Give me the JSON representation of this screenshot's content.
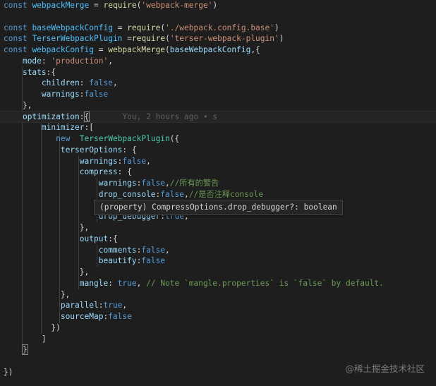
{
  "colors": {
    "background": "#1e1e1e",
    "keyword": "#569cd6",
    "variable": "#4fc1ff",
    "function": "#dcdcaa",
    "string": "#ce9178",
    "property": "#9cdcfe",
    "comment": "#6a9955",
    "class": "#4ec9b0",
    "hover_background": "#252526"
  },
  "lines": [
    [
      [
        "kw",
        "const"
      ],
      [
        "pun",
        " "
      ],
      [
        "var",
        "webpackMerge"
      ],
      [
        "pun",
        " = "
      ],
      [
        "fn",
        "require"
      ],
      [
        "pun",
        "("
      ],
      [
        "str",
        "'webpack-merge'"
      ],
      [
        "pun",
        ")"
      ]
    ],
    [],
    [
      [
        "kw",
        "const"
      ],
      [
        "pun",
        " "
      ],
      [
        "var",
        "baseWebpackConfig"
      ],
      [
        "pun",
        " = "
      ],
      [
        "fn",
        "require"
      ],
      [
        "pun",
        "("
      ],
      [
        "str",
        "'./webpack.config.base'"
      ],
      [
        "pun",
        ")"
      ]
    ],
    [
      [
        "kw",
        "const"
      ],
      [
        "pun",
        " "
      ],
      [
        "var",
        "TerserWebpackPlugin"
      ],
      [
        "pun",
        " ="
      ],
      [
        "fn",
        "require"
      ],
      [
        "pun",
        "("
      ],
      [
        "str",
        "'terser-webpack-plugin'"
      ],
      [
        "pun",
        ")"
      ]
    ],
    [
      [
        "kw",
        "const"
      ],
      [
        "pun",
        " "
      ],
      [
        "var",
        "webpackConfig"
      ],
      [
        "pun",
        " = "
      ],
      [
        "fn",
        "webpackMerge"
      ],
      [
        "pun",
        "("
      ],
      [
        "prop",
        "baseWebpackConfig"
      ],
      [
        "pun",
        ",{"
      ]
    ],
    [
      [
        "pun",
        "    "
      ],
      [
        "prop",
        "mode"
      ],
      [
        "pun",
        ": "
      ],
      [
        "str",
        "'production'"
      ],
      [
        "pun",
        ","
      ]
    ],
    [
      [
        "pun",
        "    "
      ],
      [
        "prop",
        "stats"
      ],
      [
        "pun",
        ":{"
      ]
    ],
    [
      [
        "pun",
        "        "
      ],
      [
        "prop",
        "children"
      ],
      [
        "pun",
        ": "
      ],
      [
        "kw",
        "false"
      ],
      [
        "pun",
        ","
      ]
    ],
    [
      [
        "pun",
        "        "
      ],
      [
        "prop",
        "warnings"
      ],
      [
        "pun",
        ":"
      ],
      [
        "kw",
        "false"
      ]
    ],
    [
      [
        "pun",
        "    },"
      ]
    ],
    [
      [
        "pun",
        "    "
      ],
      [
        "prop",
        "optimization"
      ],
      [
        "pun",
        ":"
      ],
      [
        "bm",
        "{"
      ],
      [
        "pun",
        "       "
      ],
      [
        "ghost",
        "You, 2 hours ago • s"
      ]
    ],
    [
      [
        "pun",
        "        "
      ],
      [
        "prop",
        "minimizer"
      ],
      [
        "pun",
        ":["
      ]
    ],
    [
      [
        "pun",
        "           "
      ],
      [
        "kw",
        "new"
      ],
      [
        "pun",
        "  "
      ],
      [
        "cls",
        "TerserWebpackPlugin"
      ],
      [
        "pun",
        "({"
      ]
    ],
    [
      [
        "pun",
        "            "
      ],
      [
        "prop",
        "terserOptions"
      ],
      [
        "pun",
        ": {"
      ]
    ],
    [
      [
        "pun",
        "                "
      ],
      [
        "prop",
        "warnings"
      ],
      [
        "pun",
        ":"
      ],
      [
        "kw",
        "false"
      ],
      [
        "pun",
        ","
      ]
    ],
    [
      [
        "pun",
        "                "
      ],
      [
        "prop",
        "compress"
      ],
      [
        "pun",
        ": {"
      ]
    ],
    [
      [
        "pun",
        "                    "
      ],
      [
        "prop",
        "warnings"
      ],
      [
        "pun",
        ":"
      ],
      [
        "kw",
        "false"
      ],
      [
        "pun",
        ","
      ],
      [
        "cmt",
        "//所有的警告"
      ]
    ],
    [
      [
        "pun",
        "                    "
      ],
      [
        "prop",
        "drop_console"
      ],
      [
        "pun",
        ":"
      ],
      [
        "kw",
        "false"
      ],
      [
        "pun",
        ","
      ],
      [
        "cmt",
        "//是否注释console"
      ]
    ],
    [],
    [
      [
        "pun",
        "                    "
      ],
      [
        "prop",
        "drop_debugger"
      ],
      [
        "pun",
        ":"
      ],
      [
        "kw",
        "true"
      ],
      [
        "pun",
        ","
      ]
    ],
    [
      [
        "pun",
        "                },"
      ]
    ],
    [
      [
        "pun",
        "                "
      ],
      [
        "prop",
        "output"
      ],
      [
        "pun",
        ":{"
      ]
    ],
    [
      [
        "pun",
        "                    "
      ],
      [
        "prop",
        "comments"
      ],
      [
        "pun",
        ":"
      ],
      [
        "kw",
        "false"
      ],
      [
        "pun",
        ","
      ]
    ],
    [
      [
        "pun",
        "                    "
      ],
      [
        "prop",
        "beautify"
      ],
      [
        "pun",
        ":"
      ],
      [
        "kw",
        "false"
      ]
    ],
    [
      [
        "pun",
        "                },"
      ]
    ],
    [
      [
        "pun",
        "                "
      ],
      [
        "prop",
        "mangle"
      ],
      [
        "pun",
        ": "
      ],
      [
        "kw",
        "true"
      ],
      [
        "pun",
        ", "
      ],
      [
        "cmt",
        "// Note `mangle.properties` is `false` by default."
      ]
    ],
    [
      [
        "pun",
        "            },"
      ]
    ],
    [
      [
        "pun",
        "            "
      ],
      [
        "prop",
        "parallel"
      ],
      [
        "pun",
        ":"
      ],
      [
        "kw",
        "true"
      ],
      [
        "pun",
        ","
      ]
    ],
    [
      [
        "pun",
        "            "
      ],
      [
        "prop",
        "sourceMap"
      ],
      [
        "pun",
        ":"
      ],
      [
        "kw",
        "false"
      ]
    ],
    [
      [
        "pun",
        "          })"
      ]
    ],
    [
      [
        "pun",
        "        ]"
      ]
    ],
    [
      [
        "pun",
        "    "
      ],
      [
        "bm",
        "}"
      ]
    ],
    [],
    [
      [
        "pun",
        "})"
      ]
    ]
  ],
  "hover": {
    "text": "(property) CompressOptions.drop_debugger?: boolean"
  },
  "watermark": "@稀土掘金技术社区"
}
